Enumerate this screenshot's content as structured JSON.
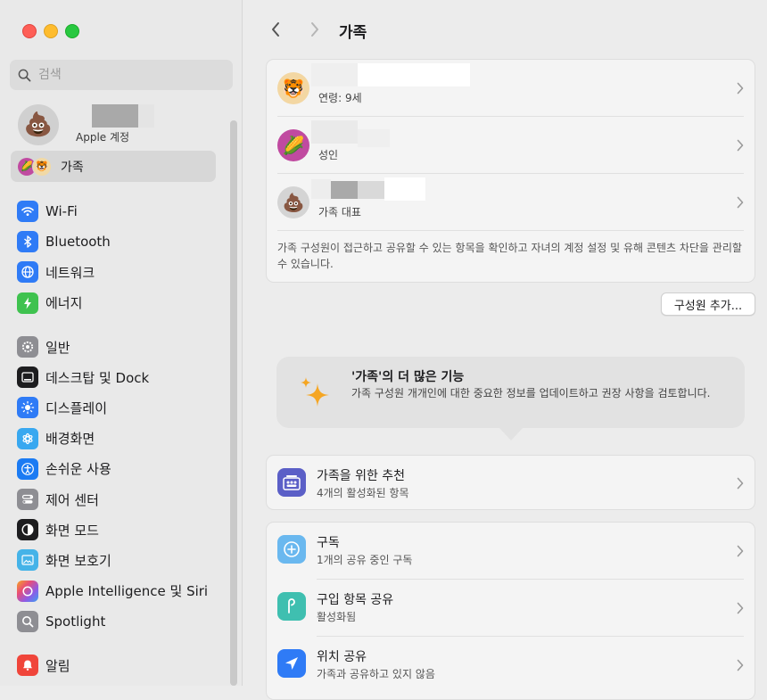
{
  "window": {
    "title": "가족"
  },
  "sidebar": {
    "search_placeholder": "검색",
    "account": {
      "subtitle": "Apple 계정",
      "avatar_emoji": "💩"
    },
    "family": {
      "label": "가족",
      "avatar_a": "🌽",
      "avatar_b": "🐯"
    },
    "items": [
      {
        "label": "Wi-Fi",
        "icon": "wifi-icon",
        "color": "#2f7bf6"
      },
      {
        "label": "Bluetooth",
        "icon": "bluetooth-icon",
        "color": "#2f7bf6"
      },
      {
        "label": "네트워크",
        "icon": "globe-icon",
        "color": "#2f7bf6"
      },
      {
        "label": "에너지",
        "icon": "battery-icon",
        "color": "#3fc24f"
      },
      {
        "label": "일반",
        "icon": "gear-icon",
        "color": "#8e8e93"
      },
      {
        "label": "데스크탑 및 Dock",
        "icon": "dock-icon",
        "color": "#1d1d1f"
      },
      {
        "label": "디스플레이",
        "icon": "brightness-icon",
        "color": "#2f7bf6"
      },
      {
        "label": "배경화면",
        "icon": "wallpaper-icon",
        "color": "#38a8f0"
      },
      {
        "label": "손쉬운 사용",
        "icon": "accessibility-icon",
        "color": "#1b7bf3"
      },
      {
        "label": "제어 센터",
        "icon": "control-center-icon",
        "color": "#8e8e93"
      },
      {
        "label": "화면 모드",
        "icon": "appearance-icon",
        "color": "#1d1d1f"
      },
      {
        "label": "화면 보호기",
        "icon": "screensaver-icon",
        "color": "#45b3e8"
      },
      {
        "label": "Apple Intelligence 및 Siri",
        "icon": "siri-icon",
        "color": "#b86de0"
      },
      {
        "label": "Spotlight",
        "icon": "spotlight-icon",
        "color": "#8e8e93"
      },
      {
        "label": "알림",
        "icon": "bell-icon",
        "color": "#f0453a"
      }
    ]
  },
  "main": {
    "members": [
      {
        "subtitle": "연령: 9세",
        "avatar_emoji": "🐯"
      },
      {
        "subtitle": "성인",
        "avatar_emoji": "🌽"
      },
      {
        "subtitle": "가족 대표",
        "avatar_emoji": "💩"
      }
    ],
    "description": "가족 구성원이 접근하고 공유할 수 있는 항목을 확인하고 자녀의 계정 설정 및 유해 콘텐츠 차단을 관리할 수 있습니다.",
    "add_member_button": "구성원 추가...",
    "promo": {
      "title": "'가족'의 더 많은 기능",
      "description": "가족 구성원 개개인에 대한 중요한 정보를 업데이트하고 권장 사항을 검토합니다."
    },
    "recommendations": {
      "title": "가족을 위한 추천",
      "subtitle": "4개의 활성화된 항목"
    },
    "features": [
      {
        "title": "구독",
        "subtitle": "1개의 공유 중인 구독",
        "icon": "subscription-icon",
        "color": "#6ab8ef"
      },
      {
        "title": "구입 항목 공유",
        "subtitle": "활성화됨",
        "icon": "purchase-sharing-icon",
        "color": "#3fbfb0"
      },
      {
        "title": "위치 공유",
        "subtitle": "가족과 공유하고 있지 않음",
        "icon": "location-icon",
        "color": "#2f7bf6"
      }
    ]
  }
}
